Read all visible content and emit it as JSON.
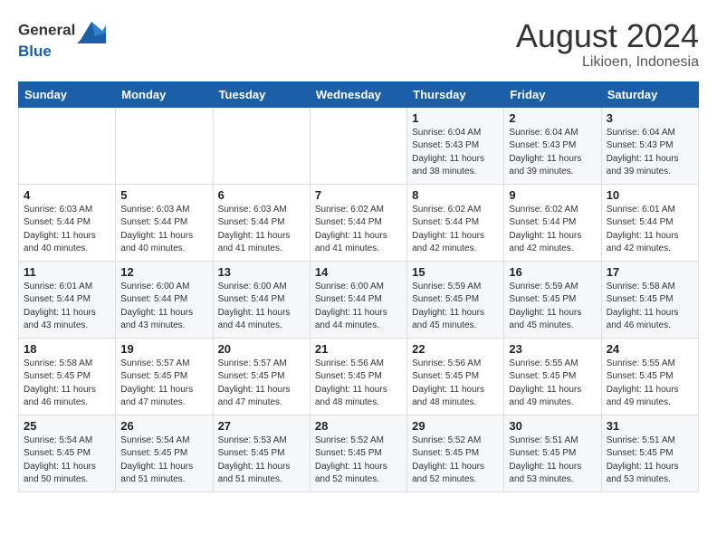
{
  "header": {
    "logo_line1": "General",
    "logo_line2": "Blue",
    "month_year": "August 2024",
    "location": "Likioen, Indonesia"
  },
  "weekdays": [
    "Sunday",
    "Monday",
    "Tuesday",
    "Wednesday",
    "Thursday",
    "Friday",
    "Saturday"
  ],
  "weeks": [
    [
      {
        "day": "",
        "info": ""
      },
      {
        "day": "",
        "info": ""
      },
      {
        "day": "",
        "info": ""
      },
      {
        "day": "",
        "info": ""
      },
      {
        "day": "1",
        "info": "Sunrise: 6:04 AM\nSunset: 5:43 PM\nDaylight: 11 hours\nand 38 minutes."
      },
      {
        "day": "2",
        "info": "Sunrise: 6:04 AM\nSunset: 5:43 PM\nDaylight: 11 hours\nand 39 minutes."
      },
      {
        "day": "3",
        "info": "Sunrise: 6:04 AM\nSunset: 5:43 PM\nDaylight: 11 hours\nand 39 minutes."
      }
    ],
    [
      {
        "day": "4",
        "info": "Sunrise: 6:03 AM\nSunset: 5:44 PM\nDaylight: 11 hours\nand 40 minutes."
      },
      {
        "day": "5",
        "info": "Sunrise: 6:03 AM\nSunset: 5:44 PM\nDaylight: 11 hours\nand 40 minutes."
      },
      {
        "day": "6",
        "info": "Sunrise: 6:03 AM\nSunset: 5:44 PM\nDaylight: 11 hours\nand 41 minutes."
      },
      {
        "day": "7",
        "info": "Sunrise: 6:02 AM\nSunset: 5:44 PM\nDaylight: 11 hours\nand 41 minutes."
      },
      {
        "day": "8",
        "info": "Sunrise: 6:02 AM\nSunset: 5:44 PM\nDaylight: 11 hours\nand 42 minutes."
      },
      {
        "day": "9",
        "info": "Sunrise: 6:02 AM\nSunset: 5:44 PM\nDaylight: 11 hours\nand 42 minutes."
      },
      {
        "day": "10",
        "info": "Sunrise: 6:01 AM\nSunset: 5:44 PM\nDaylight: 11 hours\nand 42 minutes."
      }
    ],
    [
      {
        "day": "11",
        "info": "Sunrise: 6:01 AM\nSunset: 5:44 PM\nDaylight: 11 hours\nand 43 minutes."
      },
      {
        "day": "12",
        "info": "Sunrise: 6:00 AM\nSunset: 5:44 PM\nDaylight: 11 hours\nand 43 minutes."
      },
      {
        "day": "13",
        "info": "Sunrise: 6:00 AM\nSunset: 5:44 PM\nDaylight: 11 hours\nand 44 minutes."
      },
      {
        "day": "14",
        "info": "Sunrise: 6:00 AM\nSunset: 5:44 PM\nDaylight: 11 hours\nand 44 minutes."
      },
      {
        "day": "15",
        "info": "Sunrise: 5:59 AM\nSunset: 5:45 PM\nDaylight: 11 hours\nand 45 minutes."
      },
      {
        "day": "16",
        "info": "Sunrise: 5:59 AM\nSunset: 5:45 PM\nDaylight: 11 hours\nand 45 minutes."
      },
      {
        "day": "17",
        "info": "Sunrise: 5:58 AM\nSunset: 5:45 PM\nDaylight: 11 hours\nand 46 minutes."
      }
    ],
    [
      {
        "day": "18",
        "info": "Sunrise: 5:58 AM\nSunset: 5:45 PM\nDaylight: 11 hours\nand 46 minutes."
      },
      {
        "day": "19",
        "info": "Sunrise: 5:57 AM\nSunset: 5:45 PM\nDaylight: 11 hours\nand 47 minutes."
      },
      {
        "day": "20",
        "info": "Sunrise: 5:57 AM\nSunset: 5:45 PM\nDaylight: 11 hours\nand 47 minutes."
      },
      {
        "day": "21",
        "info": "Sunrise: 5:56 AM\nSunset: 5:45 PM\nDaylight: 11 hours\nand 48 minutes."
      },
      {
        "day": "22",
        "info": "Sunrise: 5:56 AM\nSunset: 5:45 PM\nDaylight: 11 hours\nand 48 minutes."
      },
      {
        "day": "23",
        "info": "Sunrise: 5:55 AM\nSunset: 5:45 PM\nDaylight: 11 hours\nand 49 minutes."
      },
      {
        "day": "24",
        "info": "Sunrise: 5:55 AM\nSunset: 5:45 PM\nDaylight: 11 hours\nand 49 minutes."
      }
    ],
    [
      {
        "day": "25",
        "info": "Sunrise: 5:54 AM\nSunset: 5:45 PM\nDaylight: 11 hours\nand 50 minutes."
      },
      {
        "day": "26",
        "info": "Sunrise: 5:54 AM\nSunset: 5:45 PM\nDaylight: 11 hours\nand 51 minutes."
      },
      {
        "day": "27",
        "info": "Sunrise: 5:53 AM\nSunset: 5:45 PM\nDaylight: 11 hours\nand 51 minutes."
      },
      {
        "day": "28",
        "info": "Sunrise: 5:52 AM\nSunset: 5:45 PM\nDaylight: 11 hours\nand 52 minutes."
      },
      {
        "day": "29",
        "info": "Sunrise: 5:52 AM\nSunset: 5:45 PM\nDaylight: 11 hours\nand 52 minutes."
      },
      {
        "day": "30",
        "info": "Sunrise: 5:51 AM\nSunset: 5:45 PM\nDaylight: 11 hours\nand 53 minutes."
      },
      {
        "day": "31",
        "info": "Sunrise: 5:51 AM\nSunset: 5:45 PM\nDaylight: 11 hours\nand 53 minutes."
      }
    ]
  ]
}
